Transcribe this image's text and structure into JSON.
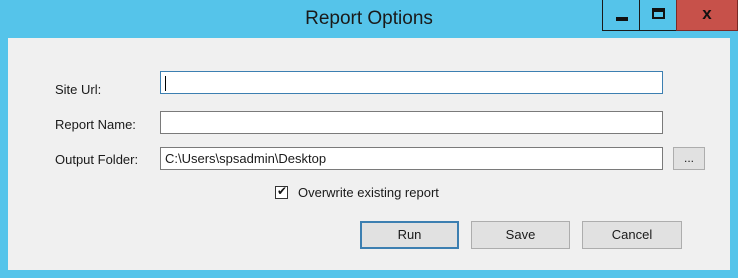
{
  "window": {
    "title": "Report Options",
    "minimize_icon": "minimize-icon",
    "maximize_icon": "maximize-icon",
    "close_glyph": "x"
  },
  "form": {
    "site_url": {
      "label": "Site Url:",
      "value": ""
    },
    "report_name": {
      "label": "Report Name:",
      "value": ""
    },
    "output_folder": {
      "label": "Output Folder:",
      "value": "C:\\Users\\spsadmin\\Desktop",
      "browse_label": "..."
    },
    "overwrite": {
      "label": "Overwrite existing report",
      "checked": true
    }
  },
  "buttons": {
    "run": "Run",
    "save": "Save",
    "cancel": "Cancel"
  },
  "colors": {
    "titlebar": "#55c4ea",
    "close_button": "#c7514a",
    "client_background": "#f0f0f0"
  }
}
